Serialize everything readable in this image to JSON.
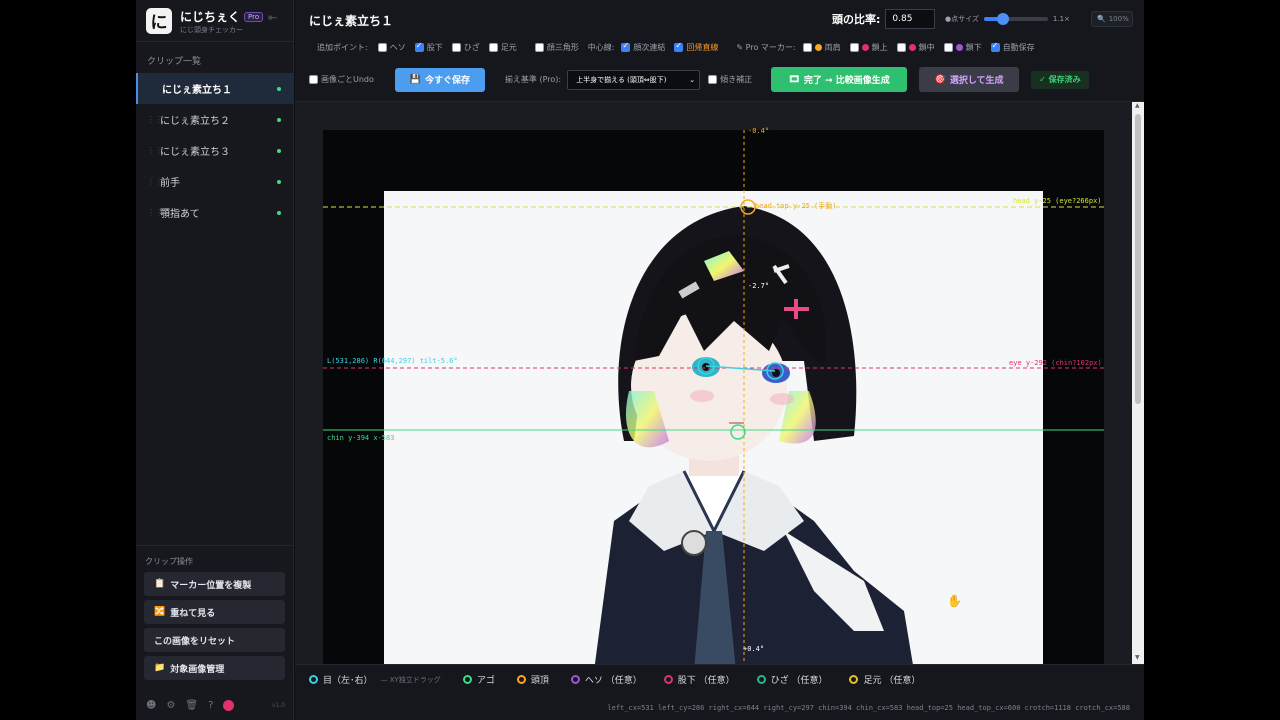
{
  "app": {
    "name": "にじちぇく",
    "subtitle": "にじ頭身チェッカー",
    "badge": "Pro",
    "version": "v1.0"
  },
  "sidebar": {
    "clips_label": "クリップ一覧",
    "clips": [
      {
        "label": "にじぇ素立ち１"
      },
      {
        "label": "にじぇ素立ち２"
      },
      {
        "label": "にじぇ素立ち３"
      },
      {
        "label": "前手"
      },
      {
        "label": "顎指あて"
      }
    ],
    "ops_label": "クリップ操作",
    "ops": [
      {
        "icon": "📋",
        "label": "マーカー位置を複製"
      },
      {
        "icon": "🔀",
        "label": "重ねて見る"
      },
      {
        "icon": "",
        "label": "この画像をリセット"
      },
      {
        "icon": "📁",
        "label": "対象画像管理"
      }
    ]
  },
  "header": {
    "title": "にじぇ素立ち１",
    "ratio_label": "頭の比率:",
    "ratio_value": "0.85",
    "point_size_label": "●点サイズ",
    "point_size_value": "1.1×",
    "zoom": "100%",
    "point_size_level": 0.3
  },
  "options": {
    "extra_points_label": "追加ポイント:",
    "extra_points": [
      {
        "label": "ヘソ",
        "checked": false
      },
      {
        "label": "股下",
        "checked": true
      },
      {
        "label": "ひざ",
        "checked": false
      },
      {
        "label": "足元",
        "checked": false
      }
    ],
    "triangle_label": "顔三角形",
    "center_label": "中心線:",
    "center_options": [
      {
        "label": "顔次連結",
        "checked": true
      },
      {
        "label": "回帰直線",
        "checked": true
      }
    ],
    "pro_marker_label": "Pro マーカー:",
    "pro_markers": [
      {
        "label": "両肩",
        "color": "#f5a623"
      },
      {
        "label": "鎖上",
        "color": "#e0336b"
      },
      {
        "label": "鎖中",
        "color": "#e0336b"
      },
      {
        "label": "鎖下",
        "color": "#9b59d6"
      }
    ],
    "autosave_label": "自動保存",
    "undo_label": "画像ごとUndo",
    "save_now": "今すぐ保存",
    "align_label": "揃え基準 (Pro):",
    "align_value": "上半身で揃える (頭頂⇔股下)",
    "tilt_label": "傾き補正",
    "done_button": "完了 → 比較画像生成",
    "generate_button": "選択して生成",
    "saved_status": "✓ 保存済み"
  },
  "canvas": {
    "annotations": {
      "top_angle": "-0.4°",
      "head_top": "head top y-25 (手動)",
      "head_line": "head y-25 (eye?266px)",
      "face_angle": "-2.7°",
      "eyes": "L(531,286)  R(644,297)  tilt-5.6°",
      "eye_line": "eye y-292 (chin?102px)",
      "chin": "chin y-394 x-583",
      "bottom_angle": "+0.4°"
    }
  },
  "legend": {
    "items": [
      {
        "label": "目（左･右）",
        "color": "#3fd0e0"
      },
      {
        "label": "アゴ",
        "color": "#3ddc84"
      },
      {
        "label": "頭頂",
        "color": "#f5a623"
      },
      {
        "label": "ヘソ （任意）",
        "color": "#9b59d6"
      },
      {
        "label": "股下 （任意）",
        "color": "#e0336b"
      },
      {
        "label": "ひざ （任意）",
        "color": "#2bb38f"
      },
      {
        "label": "足元 （任意）",
        "color": "#e6c02a"
      }
    ],
    "note": "— XY独立ドラッグ",
    "coords": "left_cx=531 left_cy=286 right_cx=644 right_cy=297 chin=394 chin_cx=583 head_top=25 head_top_cx=600 crotch=1118 crotch_cx=588"
  }
}
